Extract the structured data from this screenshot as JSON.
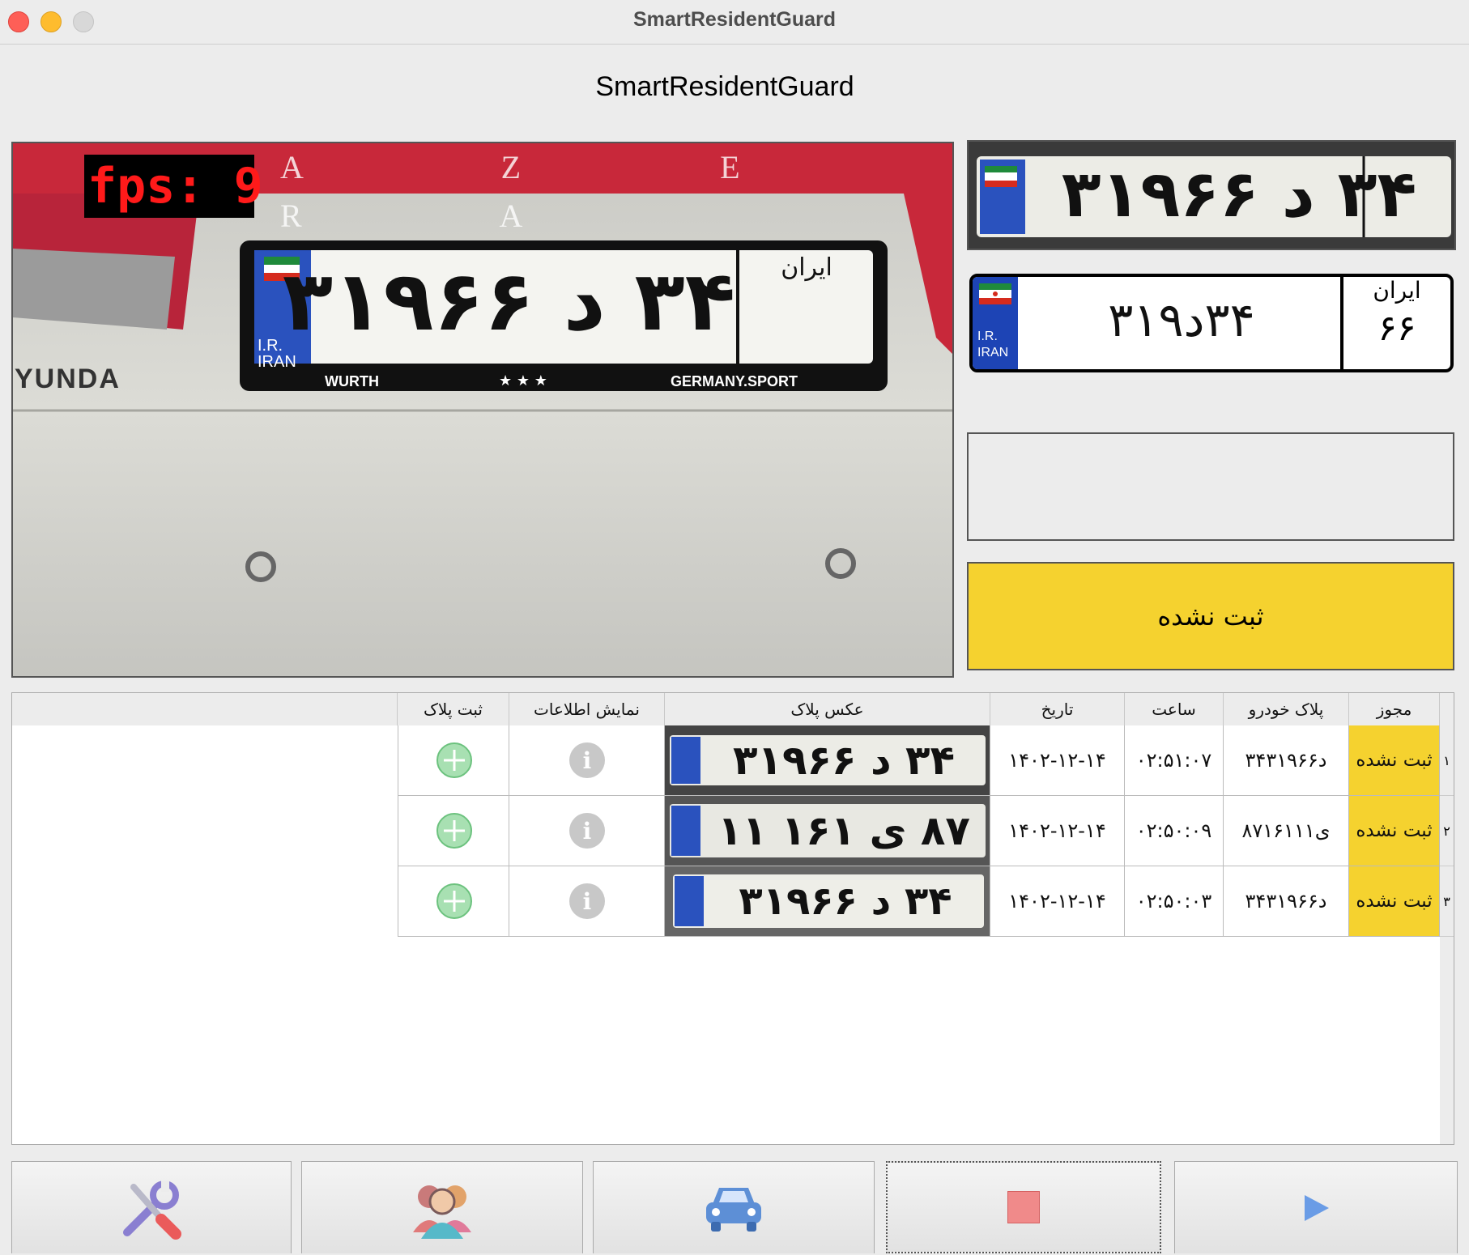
{
  "window": {
    "title": "SmartResidentGuard"
  },
  "app": {
    "title": "SmartResidentGuard"
  },
  "camera": {
    "fps_label": "fps: 9",
    "plate_text": "۳۴ د ۳۱۹۶۶",
    "plate_region": "ایران",
    "plate_ir": "I.R.",
    "plate_iran": "IRAN",
    "frame_brand": "WURTH",
    "frame_stars": "★ ★ ★",
    "frame_sport": "GERMANY.SPORT",
    "car_model": "YUNDA",
    "trunk_letters": "A Z E R A"
  },
  "detected_plate": {
    "main": "۳۴د۳۱۹",
    "region": "۶۶",
    "region_label": "ایران",
    "ir": "I.R.",
    "iran": "IRAN"
  },
  "owner_info": "",
  "status": {
    "label": "ثبت نشده",
    "color": "#f5d22f"
  },
  "table": {
    "headers": {
      "permit": "مجوز",
      "plate": "پلاک خودرو",
      "time": "ساعت",
      "date": "تاریخ",
      "photo": "عکس پلاک",
      "info": "نمایش اطلاعات",
      "register": "ثبت پلاک"
    },
    "rows": [
      {
        "num": "۱",
        "permit": "ثبت نشده",
        "plate": "۳۴د۳۱۹۶۶",
        "time": "۰۲:۵۱:۰۷",
        "date": "۱۴۰۲-۱۲-۱۴",
        "photo_text": "۳۴ د ۳۱۹۶۶"
      },
      {
        "num": "۲",
        "permit": "ثبت نشده",
        "plate": "۸۷ی۱۶۱۱۱",
        "time": "۰۲:۵۰:۰۹",
        "date": "۱۴۰۲-۱۲-۱۴",
        "photo_text": "۸۷ ی ۱۶۱ ۱۱"
      },
      {
        "num": "۳",
        "permit": "ثبت نشده",
        "plate": "۳۴د۳۱۹۶۶",
        "time": "۰۲:۵۰:۰۳",
        "date": "۱۴۰۲-۱۲-۱۴",
        "photo_text": "۳۴ د ۳۱۹۶۶"
      }
    ]
  },
  "toolbar": {
    "icons": [
      "tools-icon",
      "users-icon",
      "car-icon",
      "stop-icon",
      "play-icon"
    ]
  }
}
